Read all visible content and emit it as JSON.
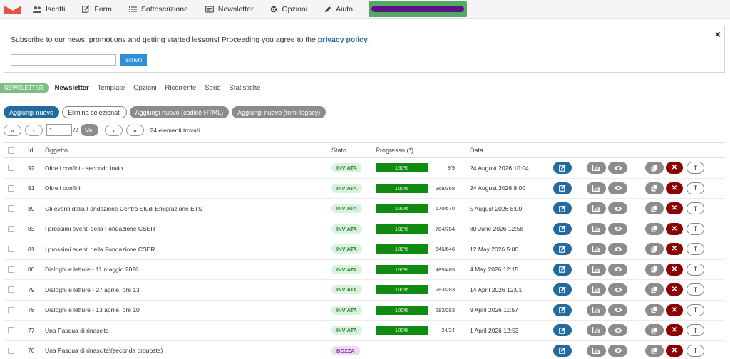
{
  "nav": {
    "items": [
      {
        "label": "Iscritti",
        "icon": "users-icon"
      },
      {
        "label": "Form",
        "icon": "edit-icon"
      },
      {
        "label": "Sottoscrizione",
        "icon": "list-icon"
      },
      {
        "label": "Newsletter",
        "icon": "newsletter-icon"
      },
      {
        "label": "Opzioni",
        "icon": "gear-icon"
      },
      {
        "label": "Aiuto",
        "icon": "pen-icon"
      }
    ]
  },
  "subscribe": {
    "message": "Subscribe to our news, promotions and getting started lessons! Proceeding you agree to the ",
    "link": "privacy policy",
    "period": ".",
    "button": "Iscriviti",
    "close": "×"
  },
  "subtabs": {
    "badge": "NEWSLETTER",
    "items": [
      "Newsletter",
      "Template",
      "Opzioni",
      "Ricorrente",
      "Serie",
      "Statistiche"
    ]
  },
  "actions": {
    "add": "Aggiungi nuovo",
    "delete": "Elimina selezionati",
    "add_html": "Aggiungi nuovo (codice HTML)",
    "add_legacy": "Aggiungi nuovo (temi legacy)"
  },
  "pager": {
    "first": "«",
    "prev": "‹",
    "page": "1",
    "total": "/2",
    "go": "Vai",
    "next": "›",
    "last": "»",
    "found": "24 elementi trovati"
  },
  "table": {
    "headers": {
      "id": "Id",
      "subject": "Oggetto",
      "status": "Stato",
      "progress": "Progresso (*)",
      "date": "Data"
    },
    "t_label": "T",
    "rows": [
      {
        "id": "92",
        "subject": "Oltre i confini - secondo invio",
        "status": "INVIATA",
        "progress": "100%",
        "progress_value": 1.0,
        "count": "9/9",
        "date": "24 August 2026 10:04"
      },
      {
        "id": "91",
        "subject": "Oltre i confini",
        "status": "INVIATA",
        "progress": "100%",
        "progress_value": 1.0,
        "count": "368/368",
        "date": "24 August 2026 8:00"
      },
      {
        "id": "89",
        "subject": "Gli eventi della Fondazione Centro Studi Emigrazione ETS",
        "status": "INVIATA",
        "progress": "100%",
        "progress_value": 1.0,
        "count": "570/570",
        "date": "5 August 2026 8:00"
      },
      {
        "id": "83",
        "subject": "I prossimi eventi della Fondazione CSER",
        "status": "INVIATA",
        "progress": "100%",
        "progress_value": 1.0,
        "count": "784/784",
        "date": "30 June 2026 12:58"
      },
      {
        "id": "81",
        "subject": "I prossimi eventi della Fondazione CSER",
        "status": "INVIATA",
        "progress": "100%",
        "progress_value": 1.0,
        "count": "646/646",
        "date": "12 May 2026 5:00"
      },
      {
        "id": "80",
        "subject": "Dialoghi e letture - 11 maggio 2026",
        "status": "INVIATA",
        "progress": "100%",
        "progress_value": 1.0,
        "count": "485/485",
        "date": "4 May 2026 12:15"
      },
      {
        "id": "79",
        "subject": "Dialoghi e letture - 27 aprile, ore 13",
        "status": "INVIATA",
        "progress": "100%",
        "progress_value": 1.0,
        "count": "283/283",
        "date": "14 April 2026 12:01"
      },
      {
        "id": "78",
        "subject": "Dialoghi e letture - 13 aprile, ore 10",
        "status": "INVIATA",
        "progress": "100%",
        "progress_value": 1.0,
        "count": "283/283",
        "date": "9 April 2026 11:57"
      },
      {
        "id": "77",
        "subject": "Una Pasqua di rinascita",
        "status": "INVIATA",
        "progress": "100%",
        "progress_value": 1.0,
        "count": "24/24",
        "date": "1 April 2026 12:53"
      },
      {
        "id": "76",
        "subject": "Una Pasqua di rinascita!(seconda proposta)",
        "status": "BOZZA",
        "progress": "",
        "count": "",
        "date": ""
      }
    ]
  },
  "colors": {
    "primary": "#236aa0",
    "success": "#108a10",
    "danger": "#8b0000",
    "neutral": "#8c8c8c",
    "accent_link": "#2b6aa3"
  }
}
